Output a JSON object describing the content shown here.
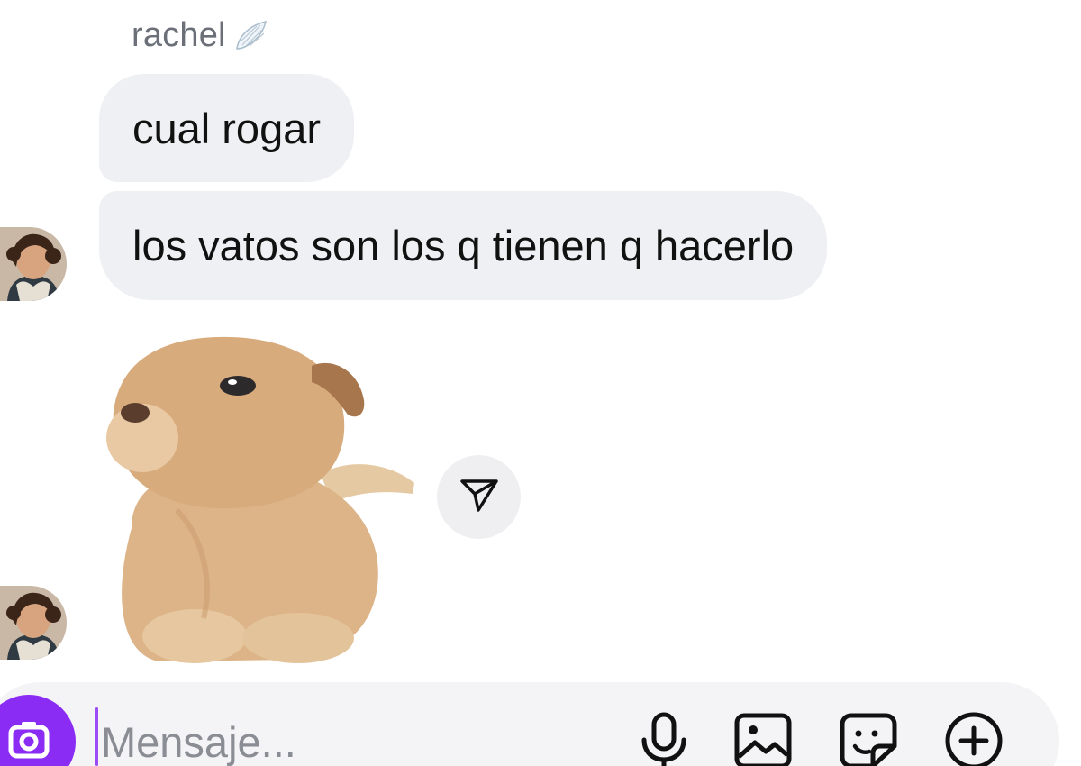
{
  "chat": {
    "sender_name": "rachel",
    "messages": [
      {
        "text": "cual rogar"
      },
      {
        "text": "los vatos son los q tienen q hacerlo"
      }
    ],
    "sticker": {
      "icon": "puppy-sticker"
    },
    "share_icon": "share-send-icon"
  },
  "composer": {
    "placeholder": "Mensaje...",
    "value": "",
    "icons": [
      "camera-icon",
      "microphone-icon",
      "gallery-icon",
      "sticker-icon",
      "plus-icon"
    ]
  },
  "colors": {
    "accent": "#8b2cf5",
    "bubble": "#eff0f3",
    "composer_bg": "#f4f4f6",
    "secondary_text": "#6b6f78"
  }
}
